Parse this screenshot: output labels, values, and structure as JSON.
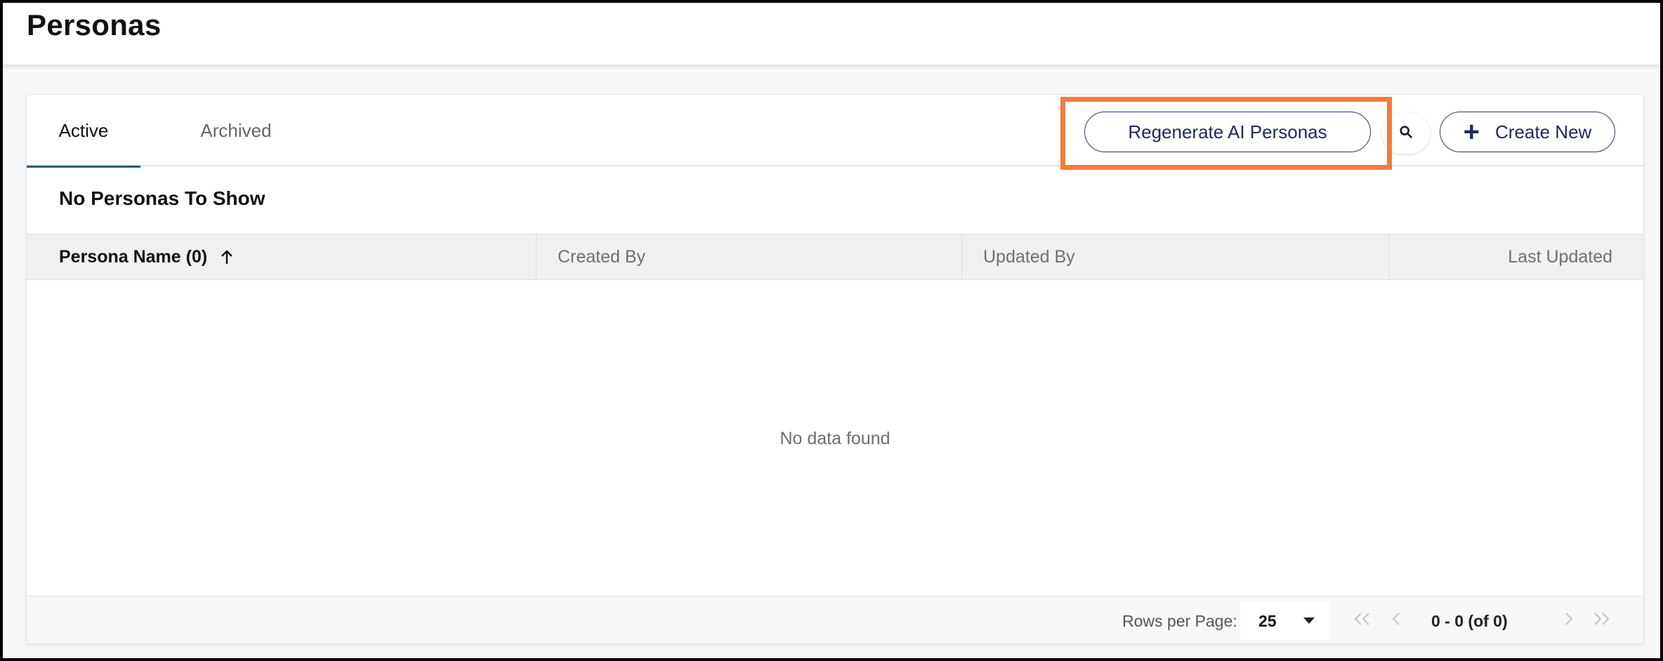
{
  "page": {
    "title": "Personas"
  },
  "tabs": [
    {
      "label": "Active",
      "active": true
    },
    {
      "label": "Archived",
      "active": false
    }
  ],
  "toolbar": {
    "regenerate_label": "Regenerate AI Personas",
    "search_icon": "search-icon",
    "create_label": "Create New"
  },
  "empty_title": "No Personas To Show",
  "table": {
    "columns": [
      {
        "label": "Persona Name (0)",
        "sorted": "ascending"
      },
      {
        "label": "Created By"
      },
      {
        "label": "Updated By"
      },
      {
        "label": "Last Updated"
      }
    ],
    "empty_message": "No data found"
  },
  "pagination": {
    "rows_label": "Rows per Page:",
    "rows_per_page": "25",
    "status": "0 - 0 (of 0)"
  },
  "colors": {
    "highlight": "#f47c3c",
    "button_text": "#1e2a5a",
    "active_tab_underline": "#1f5f7a"
  }
}
